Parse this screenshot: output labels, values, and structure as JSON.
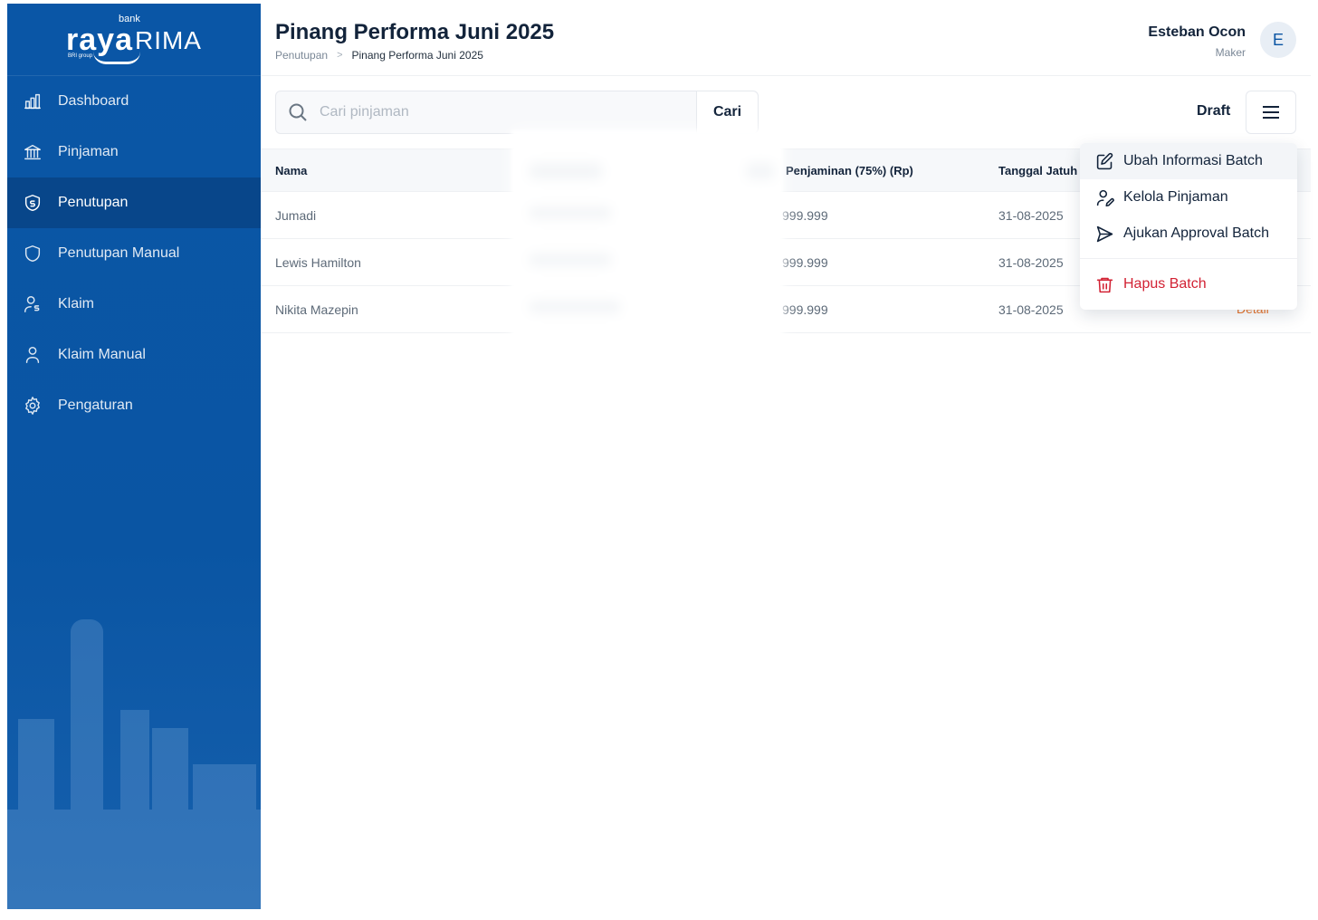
{
  "brand": {
    "bank_label": "bank",
    "name_a": "raya",
    "name_b": "RIMA",
    "group_label": "BRI group"
  },
  "sidebar": {
    "items": [
      {
        "label": "Dashboard",
        "icon": "chart-bar-icon"
      },
      {
        "label": "Pinjaman",
        "icon": "bank-icon"
      },
      {
        "label": "Penutupan",
        "icon": "shield-dollar-icon",
        "active": true
      },
      {
        "label": "Penutupan Manual",
        "icon": "shield-icon"
      },
      {
        "label": "Klaim",
        "icon": "user-dollar-icon"
      },
      {
        "label": "Klaim Manual",
        "icon": "user-icon"
      },
      {
        "label": "Pengaturan",
        "icon": "gear-icon"
      }
    ]
  },
  "header": {
    "title": "Pinang Performa Juni 2025",
    "breadcrumb": [
      "Penutupan",
      "Pinang Performa Juni 2025"
    ],
    "breadcrumb_separator": ">",
    "user_name": "Esteban Ocon",
    "user_role": "Maker",
    "avatar_initial": "E"
  },
  "toolbar": {
    "search_placeholder": "Cari pinjaman",
    "search_value": "",
    "search_button": "Cari",
    "status": "Draft"
  },
  "table": {
    "columns": [
      "Nama",
      "Penjaminan (75%) (Rp)",
      "Tanggal Jatuh"
    ],
    "rows": [
      {
        "nama": "Jumadi",
        "penjaminan": "999.999",
        "tanggal": "31-08-2025"
      },
      {
        "nama": "Lewis Hamilton",
        "penjaminan": "999.999",
        "tanggal": "31-08-2025"
      },
      {
        "nama": "Nikita Mazepin",
        "penjaminan": "999.999",
        "tanggal": "31-08-2025"
      }
    ],
    "detail_label": "Detail"
  },
  "menu": {
    "items": [
      {
        "label": "Ubah Informasi Batch",
        "icon": "edit-icon"
      },
      {
        "label": "Kelola Pinjaman",
        "icon": "user-edit-icon"
      },
      {
        "label": "Ajukan Approval Batch",
        "icon": "send-icon"
      },
      {
        "label": "Hapus Batch",
        "icon": "trash-icon",
        "danger": true
      }
    ]
  },
  "colors": {
    "sidebar_bg": "#0a55a3",
    "sidebar_active": "#08468a",
    "danger": "#d22234",
    "accent_orange": "#e8742b"
  }
}
